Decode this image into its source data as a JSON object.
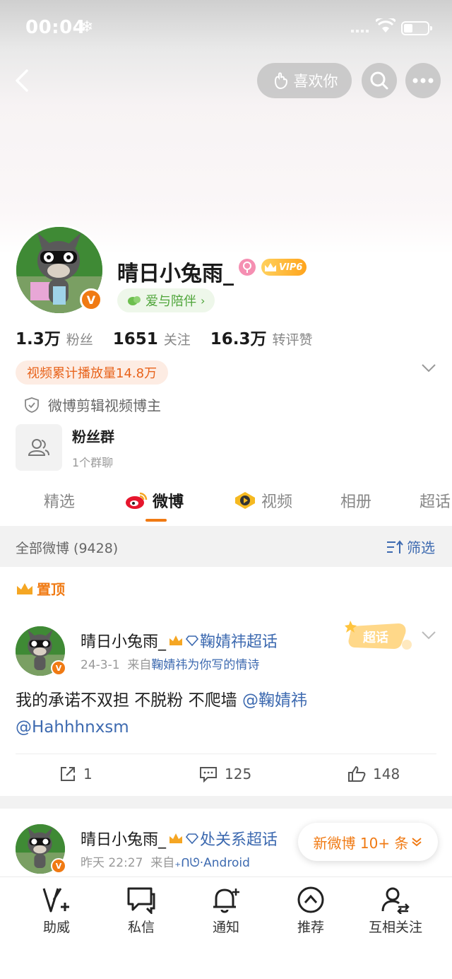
{
  "status_bar": {
    "time": "00:04",
    "snow": "❄"
  },
  "top_nav": {
    "like_label": "喜欢你"
  },
  "profile": {
    "name": "晴日小兔雨_",
    "vip_label": "VIP6",
    "tag_label": "爱与陪伴",
    "stats": [
      {
        "num": "1.3万",
        "label": "粉丝"
      },
      {
        "num": "1651",
        "label": "关注"
      },
      {
        "num": "16.3万",
        "label": "转评赞"
      }
    ],
    "video_pill": "视频累计播放量14.8万",
    "verify_text": "微博剪辑视频博主",
    "fan_group": {
      "title": "粉丝群",
      "sub": "1个群聊"
    }
  },
  "tabs": [
    {
      "label": "精选"
    },
    {
      "label": "微博"
    },
    {
      "label": "视频"
    },
    {
      "label": "相册"
    },
    {
      "label": "超话"
    }
  ],
  "feed": {
    "count_label": "全部微博 (9428)",
    "filter_label": "筛选"
  },
  "pinned_label": "置顶",
  "posts": [
    {
      "name": "晴日小兔雨_",
      "supertopic": "鞠婧祎超话",
      "date": "24-3-1",
      "from_prefix": "来自",
      "source": "鞠婧祎为你写的情诗",
      "text": "我的承诺不双担 不脱粉 不爬墙 ",
      "mention1": "@鞠婧祎",
      "mention2": "@Hahhhnxsm",
      "badge": "超话",
      "reposts": "1",
      "comments": "125",
      "likes": "148"
    },
    {
      "name": "晴日小兔雨_",
      "supertopic": "处关系超话",
      "date": "昨天 22:27",
      "from_prefix": "来自",
      "source": "₊ᑎᘎ·Android"
    }
  ],
  "new_posts_pill": "新微博 10+ 条",
  "bottom_nav": [
    {
      "label": "助威"
    },
    {
      "label": "私信"
    },
    {
      "label": "通知"
    },
    {
      "label": "推荐"
    },
    {
      "label": "互相关注"
    }
  ],
  "colors": {
    "accent": "#f07a13",
    "link": "#3d6ab0",
    "green": "#4fa53a"
  }
}
